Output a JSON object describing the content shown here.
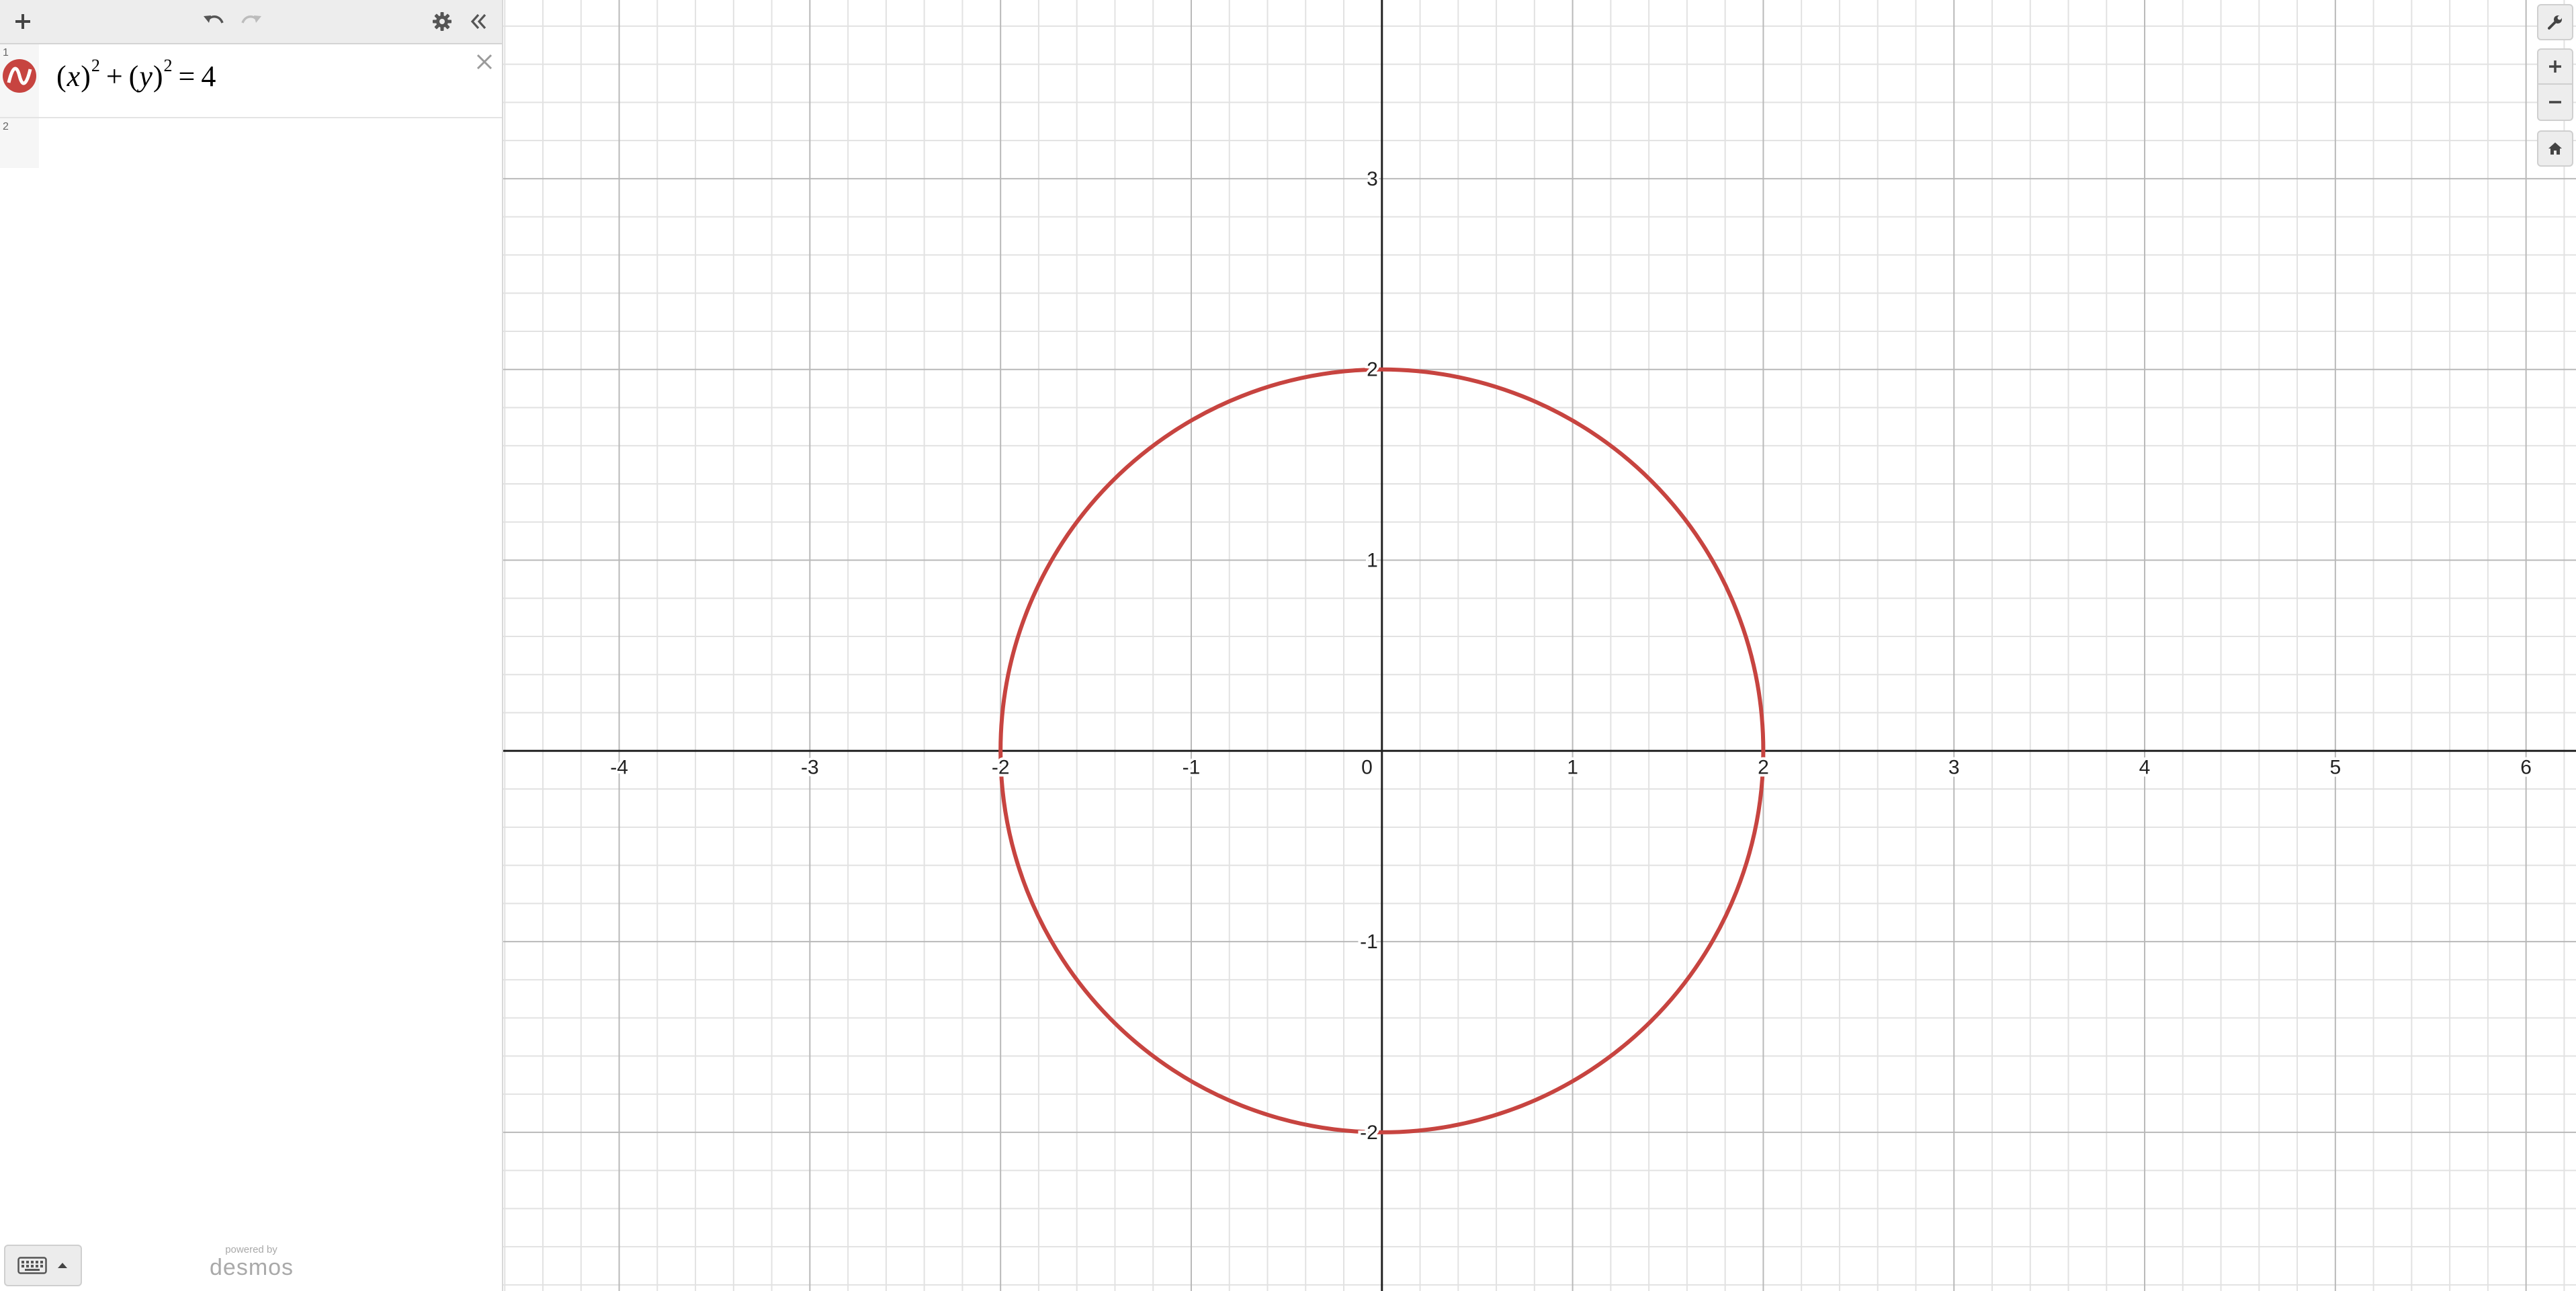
{
  "toolbar": {
    "add_icon": "plus-icon",
    "undo_icon": "undo-icon",
    "redo_icon": "redo-icon",
    "settings_icon": "gear-icon",
    "collapse_icon": "double-chevron-left-icon"
  },
  "expressions": [
    {
      "index": "1",
      "color": "#c74440",
      "latex": "(x)^2+(y)^2=4",
      "parts": {
        "lp1": "(",
        "v1": "x",
        "rp1": ")",
        "e1": "2",
        "plus": "+",
        "lp2": "(",
        "v2": "y",
        "rp2": ")",
        "e2": "2",
        "eq": "=",
        "rhs": "4"
      }
    },
    {
      "index": "2",
      "latex": ""
    }
  ],
  "footer": {
    "powered_by": "powered by",
    "brand": "desmos"
  },
  "graph": {
    "viewport": {
      "xmin": -4.608,
      "xmax": 6.262,
      "ymin": -2.832,
      "ymax": 3.937
    },
    "curve_color": "#c74440",
    "x_tick_labels": [
      "-4",
      "-3",
      "-2",
      "-1",
      "0",
      "1",
      "2",
      "3",
      "4",
      "5",
      "6"
    ],
    "y_tick_labels": [
      "3",
      "2",
      "1",
      "-1",
      "-2"
    ]
  },
  "chart_data": {
    "type": "line",
    "series": [
      {
        "equation": "(x)^2+(y)^2=4",
        "shape": "circle",
        "center": [
          0,
          0
        ],
        "radius": 2
      }
    ],
    "xlim": [
      -4.608,
      6.262
    ],
    "ylim": [
      -2.832,
      3.937
    ],
    "x_ticks": [
      -4,
      -3,
      -2,
      -1,
      0,
      1,
      2,
      3,
      4,
      5,
      6
    ],
    "y_ticks": [
      -2,
      -1,
      1,
      2,
      3
    ],
    "grid": true,
    "minor_grid_step": 0.2
  },
  "controls": {
    "wrench_icon": "wrench-icon",
    "zoom_in_icon": "zoom-in-icon",
    "zoom_out_icon": "zoom-out-icon",
    "home_icon": "home-icon",
    "keypad_icon": "keyboard-icon"
  }
}
